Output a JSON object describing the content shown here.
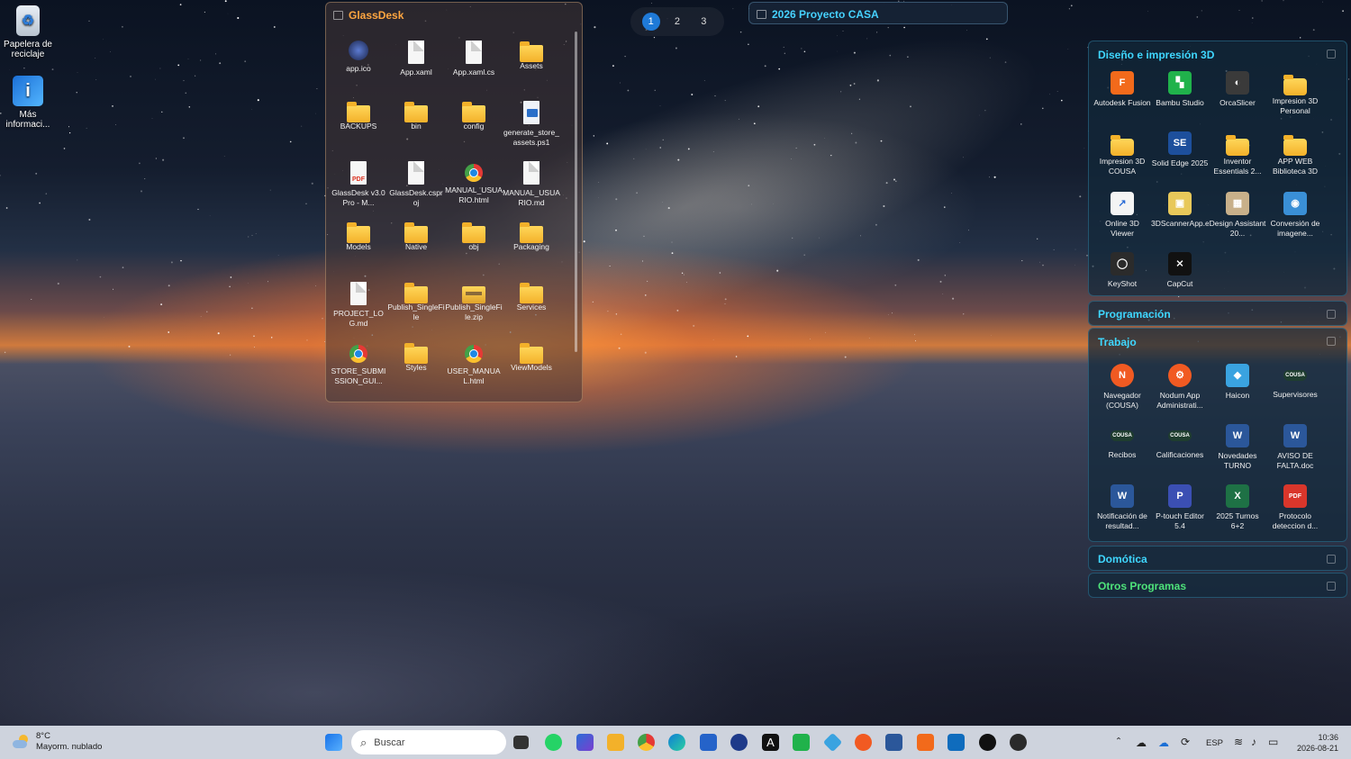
{
  "desktop": {
    "icons": [
      {
        "label": "Papelera de reciclaje",
        "icon": "recycle-bin-icon"
      },
      {
        "label": "Más informaci...",
        "icon": "info-icon"
      }
    ]
  },
  "glassdesk": {
    "title": "GlassDesk",
    "items": [
      {
        "label": "app.ico",
        "type": "ico"
      },
      {
        "label": "App.xaml",
        "type": "file"
      },
      {
        "label": "App.xaml.cs",
        "type": "file"
      },
      {
        "label": "Assets",
        "type": "folder"
      },
      {
        "label": "BACKUPS",
        "type": "folder"
      },
      {
        "label": "bin",
        "type": "folder"
      },
      {
        "label": "config",
        "type": "folder"
      },
      {
        "label": "generate_store_assets.ps1",
        "type": "ps1"
      },
      {
        "label": "GlassDesk v3.0 Pro - M...",
        "type": "pdf"
      },
      {
        "label": "GlassDesk.csproj",
        "type": "file"
      },
      {
        "label": "MANUAL_USUARIO.html",
        "type": "chrome"
      },
      {
        "label": "MANUAL_USUARIO.md",
        "type": "file"
      },
      {
        "label": "Models",
        "type": "folder"
      },
      {
        "label": "Native",
        "type": "folder"
      },
      {
        "label": "obj",
        "type": "folder"
      },
      {
        "label": "Packaging",
        "type": "folder"
      },
      {
        "label": "PROJECT_LOG.md",
        "type": "file"
      },
      {
        "label": "Publish_SingleFile",
        "type": "folder"
      },
      {
        "label": "Publish_SingleFile.zip",
        "type": "zip"
      },
      {
        "label": "Services",
        "type": "folder"
      },
      {
        "label": "STORE_SUBMISSION_GUI...",
        "type": "chrome"
      },
      {
        "label": "Styles",
        "type": "folder"
      },
      {
        "label": "USER_MANUAL.html",
        "type": "chrome"
      },
      {
        "label": "ViewModels",
        "type": "folder"
      }
    ]
  },
  "pager": {
    "pages": [
      "1",
      "2",
      "3"
    ],
    "active": "1"
  },
  "proyecto": {
    "title": "2026 Proyecto CASA"
  },
  "sidebar": {
    "diseno": {
      "title": "Diseño e impresión 3D",
      "items": [
        {
          "label": "Autodesk Fusion",
          "glyph": "F",
          "color": "#f26a1b"
        },
        {
          "label": "Bambu Studio",
          "glyph": "▚",
          "color": "#20b24b"
        },
        {
          "label": "OrcaSlicer",
          "glyph": "◐",
          "color": "#3a3a3a"
        },
        {
          "label": "Impresion 3D Personal",
          "glyph": "",
          "color": "folder"
        },
        {
          "label": "Impresion 3D COUSA",
          "glyph": "",
          "color": "folder"
        },
        {
          "label": "Solid Edge 2025",
          "glyph": "SE",
          "color": "#1d4f9c"
        },
        {
          "label": "Inventor Essentials 2...",
          "glyph": "",
          "color": "folder"
        },
        {
          "label": "APP WEB Biblioteca 3D",
          "glyph": "",
          "color": "folder"
        },
        {
          "label": "Online 3D Viewer",
          "glyph": "↗",
          "color": "#f4f4f4"
        },
        {
          "label": "3DScannerApp.exe",
          "glyph": "▣",
          "color": "#e8c85a"
        },
        {
          "label": "Design Assistant 20...",
          "glyph": "▦",
          "color": "#c8b08a"
        },
        {
          "label": "Conversión de imagene...",
          "glyph": "◉",
          "color": "#3a8fd6"
        },
        {
          "label": "KeyShot",
          "glyph": "◯",
          "color": "#2b2b2b"
        },
        {
          "label": "CapCut",
          "glyph": "⨯",
          "color": "#111111"
        }
      ]
    },
    "programacion": {
      "title": "Programación"
    },
    "trabajo": {
      "title": "Trabajo",
      "items": [
        {
          "label": "Navegador (COUSA)",
          "glyph": "N",
          "color": "#f15a22"
        },
        {
          "label": "Nodum App Administrati...",
          "glyph": "⚙",
          "color": "#f15a22"
        },
        {
          "label": "Haicon",
          "glyph": "◆",
          "color": "#3aa3e0"
        },
        {
          "label": "Supervisores",
          "glyph": "COUSA",
          "color": "#1f3d2f"
        },
        {
          "label": "Recibos",
          "glyph": "COUSA",
          "color": "#1f3d2f"
        },
        {
          "label": "Calificaciones",
          "glyph": "COUSA",
          "color": "#1f3d2f"
        },
        {
          "label": "Novedades TURNO",
          "glyph": "W",
          "color": "#2b579a"
        },
        {
          "label": "AVISO DE FALTA.doc",
          "glyph": "W",
          "color": "#2b579a"
        },
        {
          "label": "Notificación de resultad...",
          "glyph": "W",
          "color": "#2b579a"
        },
        {
          "label": "P-touch Editor 5.4",
          "glyph": "P",
          "color": "#3b4fb3"
        },
        {
          "label": "2025 Turnos 6+2",
          "glyph": "X",
          "color": "#1e7145"
        },
        {
          "label": "Protocolo deteccion d...",
          "glyph": "PDF",
          "color": "#d9362b"
        }
      ]
    },
    "domotica": {
      "title": "Domótica"
    },
    "otros": {
      "title": "Otros Programas"
    }
  },
  "taskbar": {
    "weather_temp": "8°C",
    "weather_desc": "Mayorm. nublado",
    "search_placeholder": "Buscar",
    "language": "ESP",
    "time": "10:36",
    "date": "2026-08-21"
  }
}
